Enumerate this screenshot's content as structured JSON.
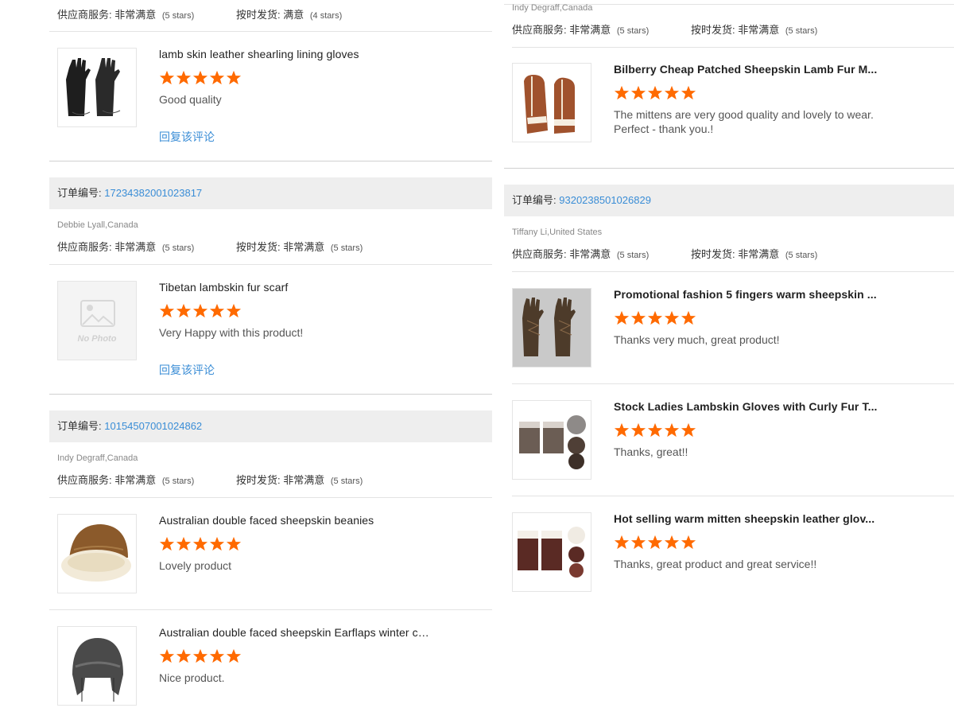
{
  "labels": {
    "order_no": "订单编号:",
    "supplier_service": "供应商服务:",
    "on_time_delivery": "按时发货:",
    "reply": "回复该评论"
  },
  "left": {
    "top_block": {
      "supplier_value": "非常满意",
      "supplier_stars": "(5 stars)",
      "delivery_value": "满意",
      "delivery_stars": "(4 stars)",
      "items": [
        {
          "title": "lamb skin leather shearling lining gloves",
          "rating": 5,
          "comment": "Good quality",
          "has_reply": true
        }
      ]
    },
    "orders": [
      {
        "order_number": "17234382001023817",
        "buyer": "Debbie Lyall,Canada",
        "supplier_value": "非常满意",
        "supplier_stars": "(5 stars)",
        "delivery_value": "非常满意",
        "delivery_stars": "(5 stars)",
        "items": [
          {
            "title": "Tibetan lambskin fur scarf",
            "rating": 5,
            "comment": "Very Happy with this product!",
            "has_reply": true,
            "thumb_placeholder": "No Photo"
          }
        ]
      },
      {
        "order_number": "10154507001024862",
        "buyer": "Indy Degraff,Canada",
        "supplier_value": "非常满意",
        "supplier_stars": "(5 stars)",
        "delivery_value": "非常满意",
        "delivery_stars": "(5 stars)",
        "items": [
          {
            "title": "Australian double faced sheepskin beanies",
            "rating": 5,
            "comment": "Lovely product"
          },
          {
            "title": "Australian double faced sheepskin Earflaps winter cap",
            "rating": 5,
            "comment": "Nice product."
          }
        ]
      }
    ]
  },
  "right": {
    "top_block": {
      "buyer": "Indy Degraff,Canada",
      "supplier_value": "非常满意",
      "supplier_stars": "(5 stars)",
      "delivery_value": "非常满意",
      "delivery_stars": "(5 stars)",
      "items": [
        {
          "title": "Bilberry Cheap Patched Sheepskin Lamb Fur M...",
          "rating": 5,
          "comment": "The mittens are very good quality and lovely to wear. Perfect - thank you.!"
        }
      ]
    },
    "orders": [
      {
        "order_number": "9320238501026829",
        "buyer": "Tiffany Li,United States",
        "supplier_value": "非常满意",
        "supplier_stars": "(5 stars)",
        "delivery_value": "非常满意",
        "delivery_stars": "(5 stars)",
        "items": [
          {
            "title": "Promotional fashion 5 fingers warm sheepskin ...",
            "rating": 5,
            "comment": "Thanks very much, great product!"
          },
          {
            "title": "Stock Ladies Lambskin Gloves with Curly Fur T...",
            "rating": 5,
            "comment": "Thanks, great!!"
          },
          {
            "title": "Hot selling warm mitten sheepskin leather glov...",
            "rating": 5,
            "comment": "Thanks, great product and great service!!"
          }
        ]
      }
    ]
  },
  "colors": {
    "star": "#ff6a00",
    "link": "#3a8dd6",
    "order_bar_bg": "#eeeeee"
  }
}
